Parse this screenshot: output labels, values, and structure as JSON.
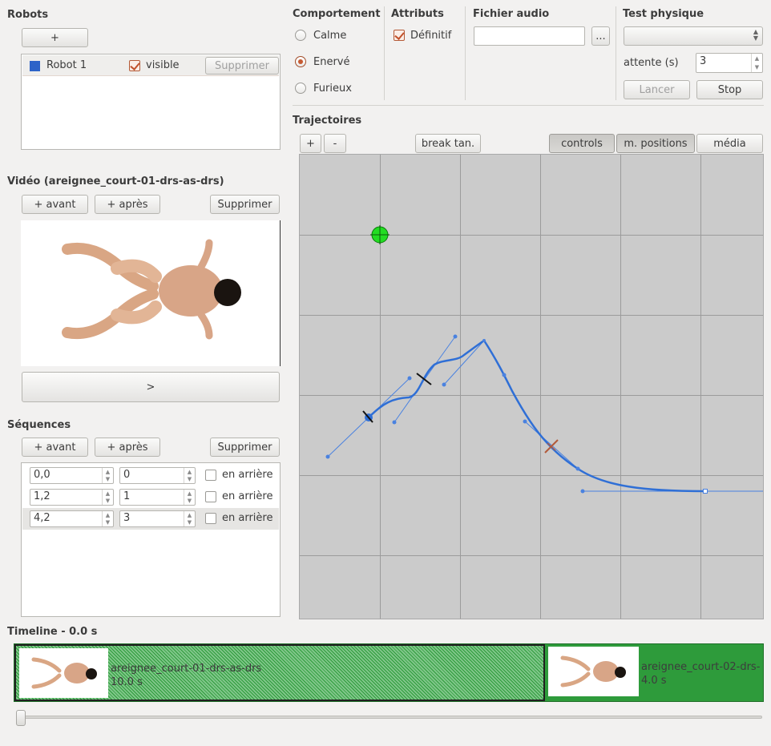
{
  "robots": {
    "title": "Robots",
    "add_label": "+",
    "list": [
      {
        "name": "Robot 1",
        "color": "#2d63c8",
        "visible_label": "visible",
        "visible": true,
        "delete_label": "Supprimer"
      }
    ]
  },
  "behavior": {
    "title": "Comportement",
    "options": [
      {
        "label": "Calme",
        "selected": false
      },
      {
        "label": "Enervé",
        "selected": true
      },
      {
        "label": "Furieux",
        "selected": false
      }
    ]
  },
  "attributes": {
    "title": "Attributs",
    "definitive_label": "Définitif",
    "definitive": true
  },
  "audio": {
    "title": "Fichier audio",
    "value": "",
    "browse_label": "..."
  },
  "physics": {
    "title": "Test physique",
    "select_value": "",
    "wait_label": "attente (s)",
    "wait_value": "3",
    "launch_label": "Lancer",
    "stop_label": "Stop"
  },
  "video": {
    "title": "Vidéo (areignee_court-01-drs-as-drs)",
    "before_label": "+ avant",
    "after_label": "+ après",
    "delete_label": "Supprimer",
    "play_label": ">"
  },
  "sequences": {
    "title": "Séquences",
    "before_label": "+ avant",
    "after_label": "+ après",
    "delete_label": "Supprimer",
    "backward_label": "en arrière",
    "rows": [
      {
        "time": "0,0",
        "index": "0",
        "backward": false,
        "selected": false
      },
      {
        "time": "1,2",
        "index": "1",
        "backward": false,
        "selected": false
      },
      {
        "time": "4,2",
        "index": "3",
        "backward": false,
        "selected": true
      }
    ]
  },
  "trajectories": {
    "title": "Trajectoires",
    "zoom_in_label": "+",
    "zoom_out_label": "-",
    "break_label": "break tan.",
    "controls_label": "controls",
    "positions_label": "m. positions",
    "media_label": "média",
    "curve_color": "#2f6fd6",
    "target_color": "#22dd22"
  },
  "timeline": {
    "title": "Timeline - 0.0 s",
    "clips": [
      {
        "name": "areignee_court-01-drs-as-drs",
        "duration": "10.0 s",
        "color": "#2e9b3b"
      },
      {
        "name": "areignee_court-02-drs-",
        "duration": "4.0 s",
        "color": "#2e9b3b"
      }
    ]
  }
}
